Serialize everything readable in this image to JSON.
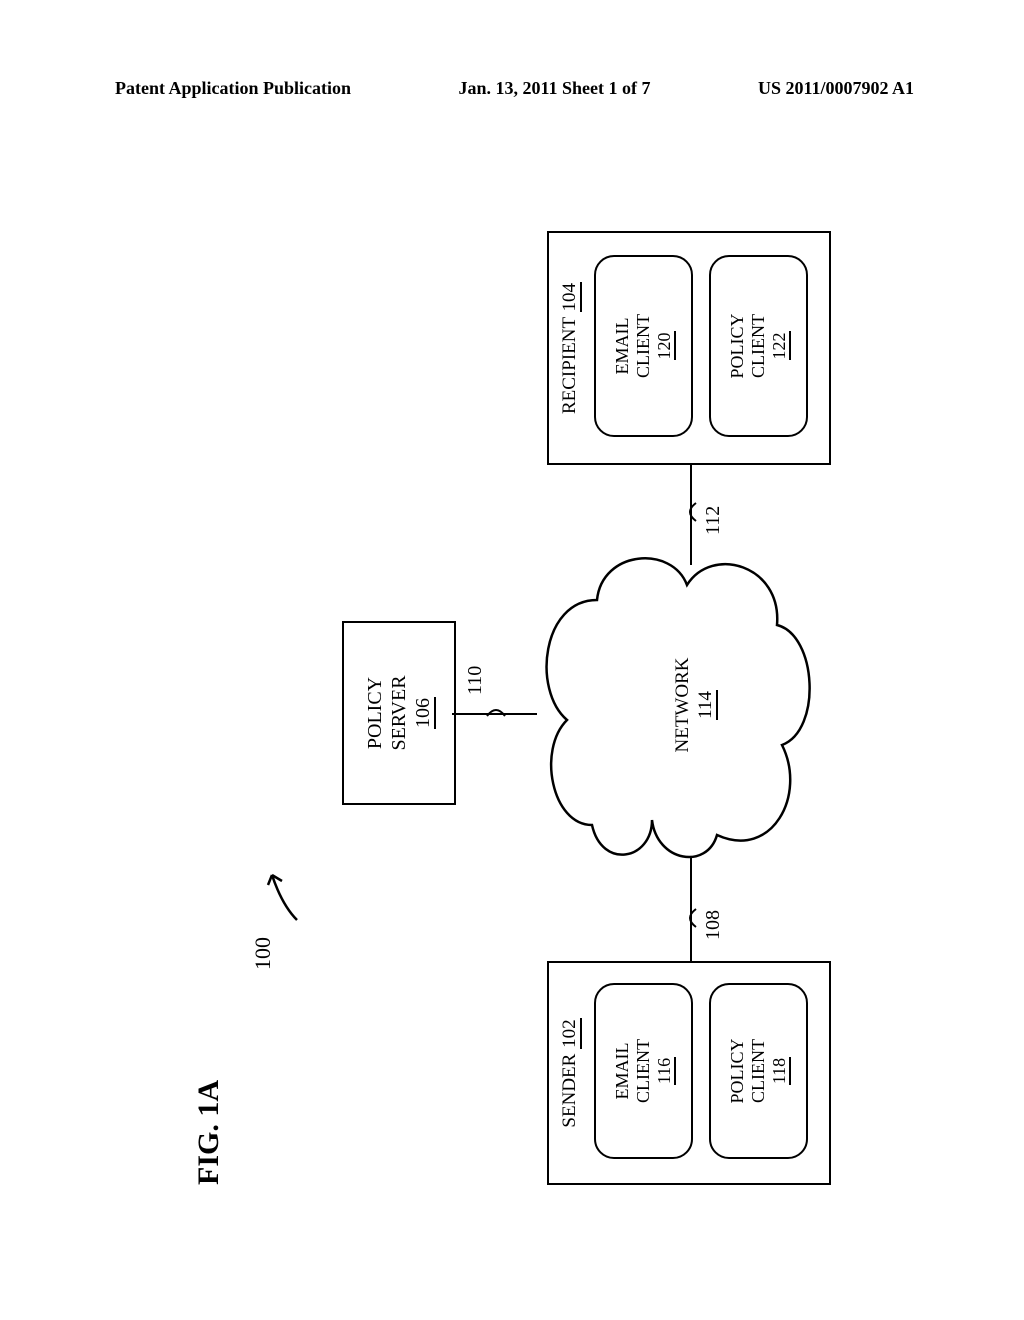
{
  "header": {
    "left": "Patent Application Publication",
    "center": "Jan. 13, 2011  Sheet 1 of 7",
    "right": "US 2011/0007902 A1"
  },
  "figure": {
    "label": "FIG. 1A",
    "system_ref": "100"
  },
  "policy_server": {
    "line1": "POLICY",
    "line2": "SERVER",
    "ref": "106"
  },
  "sender": {
    "title_prefix": "SENDER",
    "ref": "102",
    "email": {
      "line1": "EMAIL",
      "line2": "CLIENT",
      "ref": "116"
    },
    "policy": {
      "line1": "POLICY",
      "line2": "CLIENT",
      "ref": "118"
    }
  },
  "recipient": {
    "title_prefix": "RECIPIENT",
    "ref": "104",
    "email": {
      "line1": "EMAIL",
      "line2": "CLIENT",
      "ref": "120"
    },
    "policy": {
      "line1": "POLICY",
      "line2": "CLIENT",
      "ref": "122"
    }
  },
  "network": {
    "label": "NETWORK",
    "ref": "114"
  },
  "connectors": {
    "sender_link": "108",
    "server_link": "110",
    "recipient_link": "112"
  }
}
